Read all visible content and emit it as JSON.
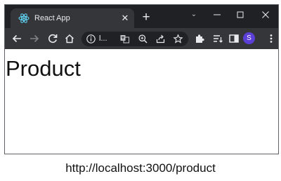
{
  "browser": {
    "tab": {
      "title": "React App",
      "close_glyph": "✕",
      "favicon": "react-logo-icon"
    },
    "new_tab_glyph": "+",
    "tab_search_glyph": "⌄",
    "window_controls": [
      "minimize-icon",
      "maximize-icon",
      "close-icon"
    ],
    "toolbar": {
      "icons": [
        "back-arrow-icon",
        "forward-arrow-icon",
        "reload-icon",
        "home-icon"
      ],
      "omnibox": {
        "url_text": "l...",
        "icons": [
          "site-info-icon",
          "translate-icon",
          "zoom-icon",
          "share-icon",
          "bookmark-star-icon"
        ]
      },
      "right_icons": [
        "extensions-puzzle-icon",
        "reading-list-icon",
        "side-panel-icon",
        "more-menu-icon"
      ],
      "profile_initial": "S"
    },
    "colors": {
      "titlebar": "#202124",
      "tab": "#35363a",
      "toolbar": "#35363a",
      "omnibox": "#202124",
      "profile": "#5b3fd6"
    }
  },
  "page": {
    "heading": "Product"
  },
  "caption": "http://localhost:3000/product"
}
